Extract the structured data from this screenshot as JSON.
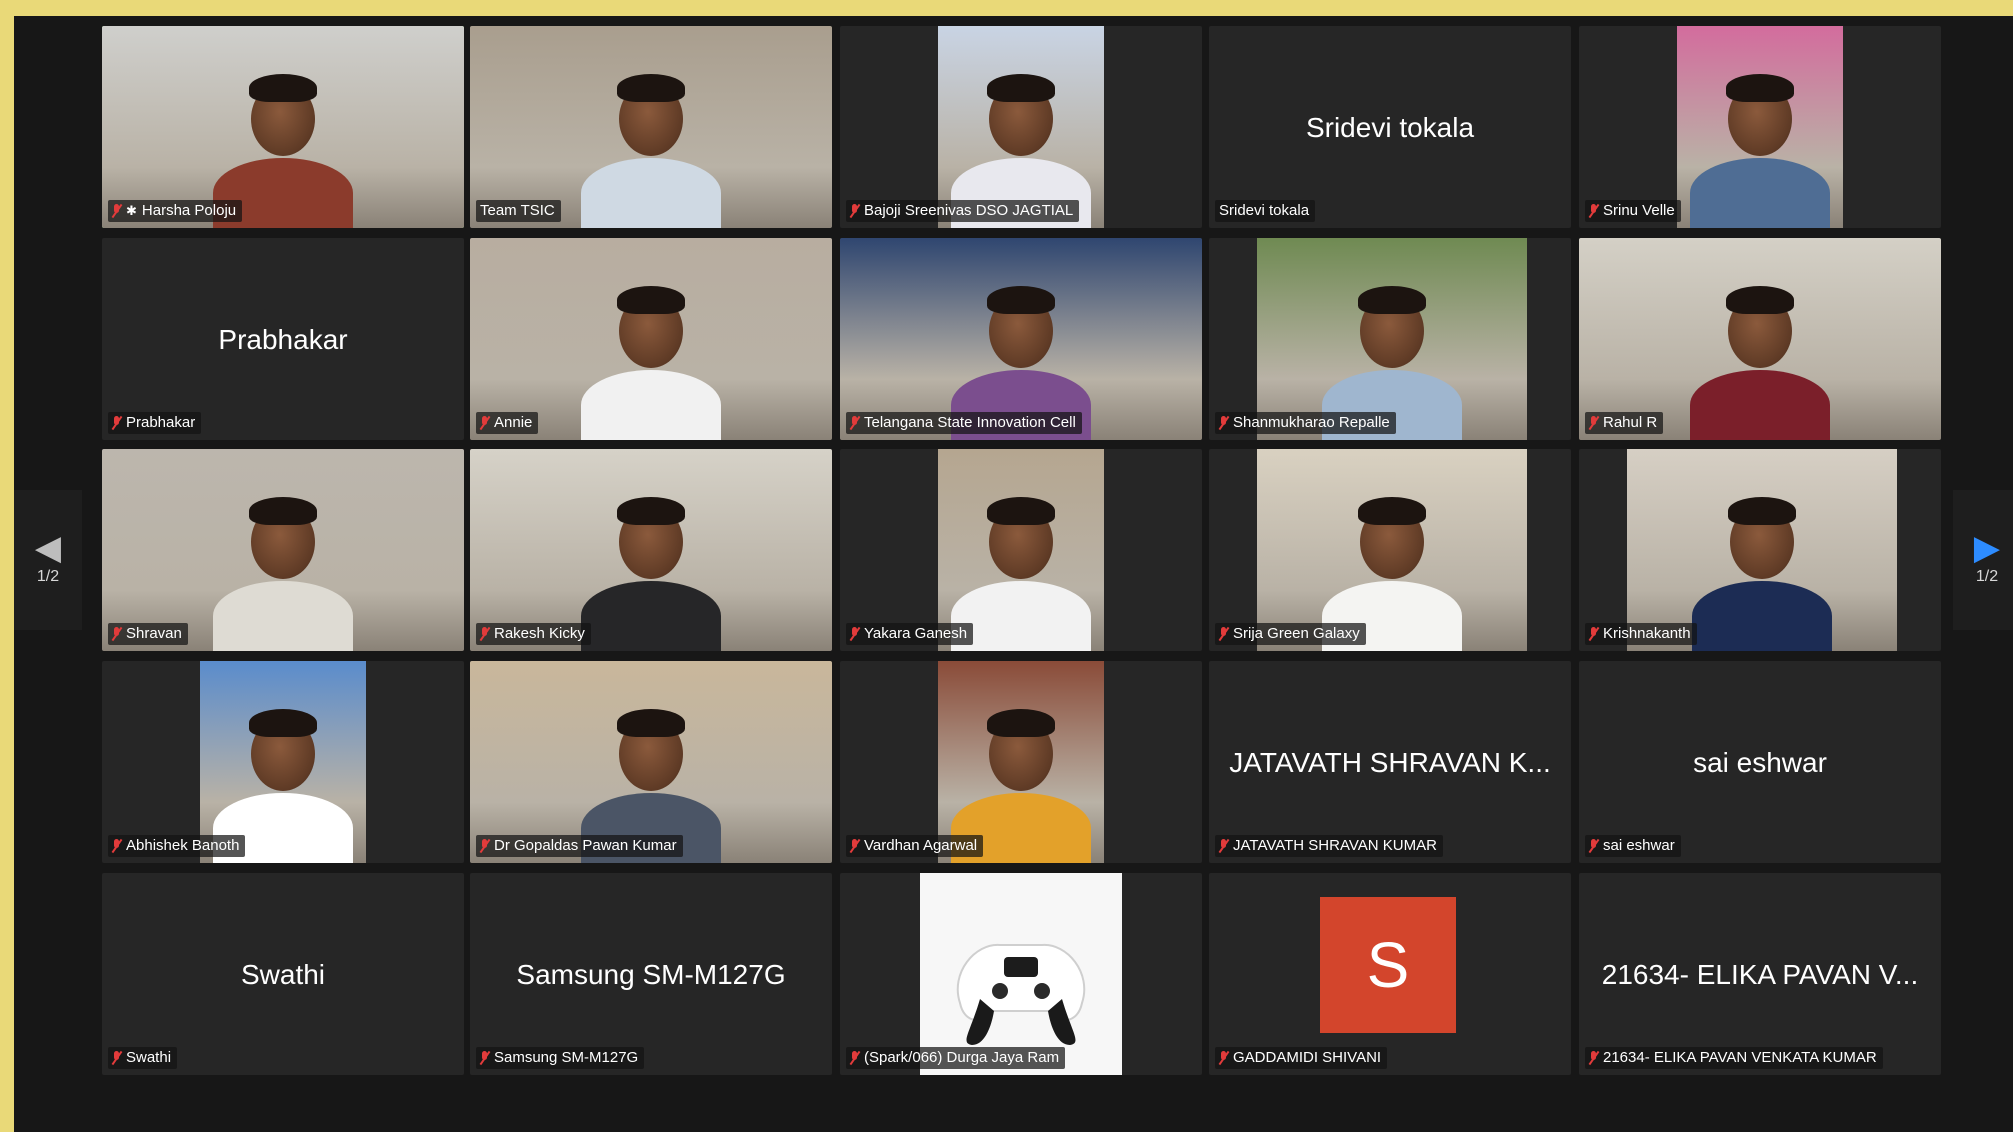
{
  "meeting": {
    "participants": [
      {
        "name": "Harsha Poloju",
        "display": "video",
        "active": true,
        "pinned": true,
        "muted": true
      },
      {
        "name": "Team TSIC",
        "display": "video",
        "muted": false
      },
      {
        "name": "Bajoji Sreenivas DSO JAGTIAL",
        "display": "video",
        "muted": true
      },
      {
        "name": "Sridevi tokala",
        "display": "name",
        "muted": false
      },
      {
        "name": "Srinu Velle",
        "display": "video",
        "muted": true
      },
      {
        "name": "Prabhakar",
        "display": "name",
        "muted": true
      },
      {
        "name": "Annie",
        "display": "video",
        "muted": true
      },
      {
        "name": "Telangana State Innovation Cell",
        "display": "video",
        "muted": true
      },
      {
        "name": "Shanmukharao Repalle",
        "display": "video",
        "muted": true
      },
      {
        "name": "Rahul R",
        "display": "video",
        "muted": true
      },
      {
        "name": "Shravan",
        "display": "video",
        "muted": true
      },
      {
        "name": "Rakesh Kicky",
        "display": "video",
        "muted": true
      },
      {
        "name": "Yakara Ganesh",
        "display": "video",
        "muted": true
      },
      {
        "name": "Srija Green Galaxy",
        "display": "video",
        "muted": true
      },
      {
        "name": "Krishnakanth",
        "display": "video",
        "muted": true
      },
      {
        "name": "Abhishek Banoth",
        "display": "video",
        "muted": true
      },
      {
        "name": "Dr Gopaldas Pawan Kumar",
        "display": "video",
        "muted": true
      },
      {
        "name": "Vardhan Agarwal",
        "display": "video",
        "muted": true
      },
      {
        "name": "JATAVATH SHRAVAN KUMAR",
        "center_text": "JATAVATH SHRAVAN K...",
        "display": "name",
        "muted": true
      },
      {
        "name": "sai eshwar",
        "display": "name",
        "muted": true
      },
      {
        "name": "Swathi",
        "display": "name",
        "muted": true
      },
      {
        "name": "Samsung SM-M127G",
        "display": "name",
        "muted": true
      },
      {
        "name": "(Spark/066) Durga Jaya Ram",
        "display": "controller",
        "muted": true
      },
      {
        "name": "GADDAMIDI SHIVANI",
        "display": "avatar",
        "avatar_letter": "S",
        "muted": true
      },
      {
        "name": "21634- ELIKA PAVAN VENKATA KUMAR",
        "center_text": "21634- ELIKA PAVAN V...",
        "display": "name",
        "muted": true
      }
    ],
    "pager_prev": {
      "icon": "triangle-left-icon",
      "page": "1/2"
    },
    "pager_next": {
      "icon": "triangle-right-icon",
      "page": "1/2"
    },
    "colors": {
      "mute": "#e23b3b",
      "active_border": "#63c763",
      "avatar": "#d3452c",
      "next_arrow": "#2d8cff",
      "frame": "#e9d978"
    }
  }
}
